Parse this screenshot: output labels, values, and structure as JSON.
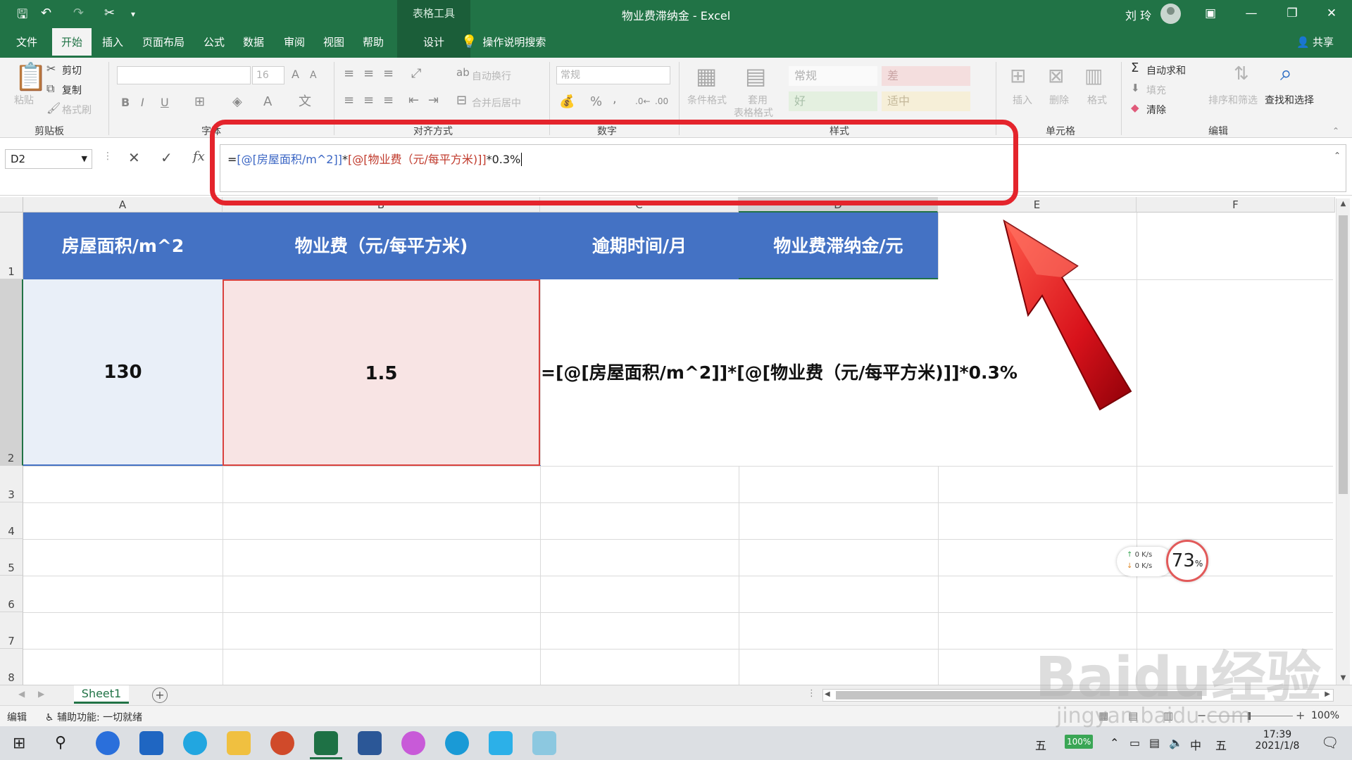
{
  "app": {
    "window_title": "物业费滞纳金 - Excel",
    "context_tab_group": "表格工具",
    "user_name": "刘 玲"
  },
  "tabs": [
    "文件",
    "开始",
    "插入",
    "页面布局",
    "公式",
    "数据",
    "审阅",
    "视图",
    "帮助",
    "设计"
  ],
  "tell_me": "操作说明搜索",
  "share": "共享",
  "ribbon": {
    "clipboard": {
      "paste": "粘贴",
      "cut": "剪切",
      "copy": "复制",
      "format_painter": "格式刷",
      "title": "剪贴板"
    },
    "font": {
      "font_size": "16",
      "bold": "B",
      "italic": "I",
      "underline": "U",
      "title": "字体"
    },
    "alignment": {
      "wrap": "自动换行",
      "merge": "合并后居中",
      "title": "对齐方式"
    },
    "number": {
      "format": "常规",
      "percent": "%",
      "comma": ",",
      "title": "数字"
    },
    "styles": {
      "conditional": "条件格式",
      "table_format_1": "套用",
      "table_format_2": "表格格式",
      "normal": "常规",
      "bad": "差",
      "good": "好",
      "neutral": "适中",
      "title": "样式"
    },
    "cells": {
      "insert": "插入",
      "delete": "删除",
      "format": "格式",
      "title": "单元格"
    },
    "editing": {
      "autosum": "自动求和",
      "fill": "填充",
      "clear": "清除",
      "sort": "排序和筛选",
      "find": "查找和选择",
      "title": "编辑"
    }
  },
  "formula_bar": {
    "name_box": "D2",
    "fx": "fx",
    "formula_part1": "=",
    "formula_part2": "[@[房屋面积/m^2]]",
    "formula_part3": "*",
    "formula_part4": "[@[物业费（元/每平方米)]]",
    "formula_part5": "*0.3%"
  },
  "columns": [
    "A",
    "B",
    "C",
    "D",
    "E",
    "F"
  ],
  "rows": [
    "1",
    "2",
    "3",
    "4",
    "5",
    "6",
    "7",
    "8"
  ],
  "table": {
    "headers": [
      "房屋面积/m^2",
      "物业费（元/每平方米)",
      "逾期时间/月",
      "物业费滞纳金/元"
    ],
    "row2": [
      "130",
      "1.5",
      "=[@[房屋面积/m^2]]*[@[物业费（元/每平方米)]]*0.3%"
    ]
  },
  "sheet_tab": "Sheet1",
  "status": {
    "mode": "编辑",
    "accessibility": "辅助功能: 一切就绪",
    "zoom": "100%"
  },
  "net_widget": {
    "up": "0  K/s",
    "down": "0  K/s",
    "cpu": "73",
    "cpu_unit": "%"
  },
  "taskbar": {
    "ime": "五",
    "battery": "100%",
    "lang": "中",
    "ime2": "五",
    "time": "17:39",
    "date": "2021/1/8"
  },
  "watermark": {
    "brand": "Baidu经验",
    "url": "jingyan.baidu.com"
  }
}
